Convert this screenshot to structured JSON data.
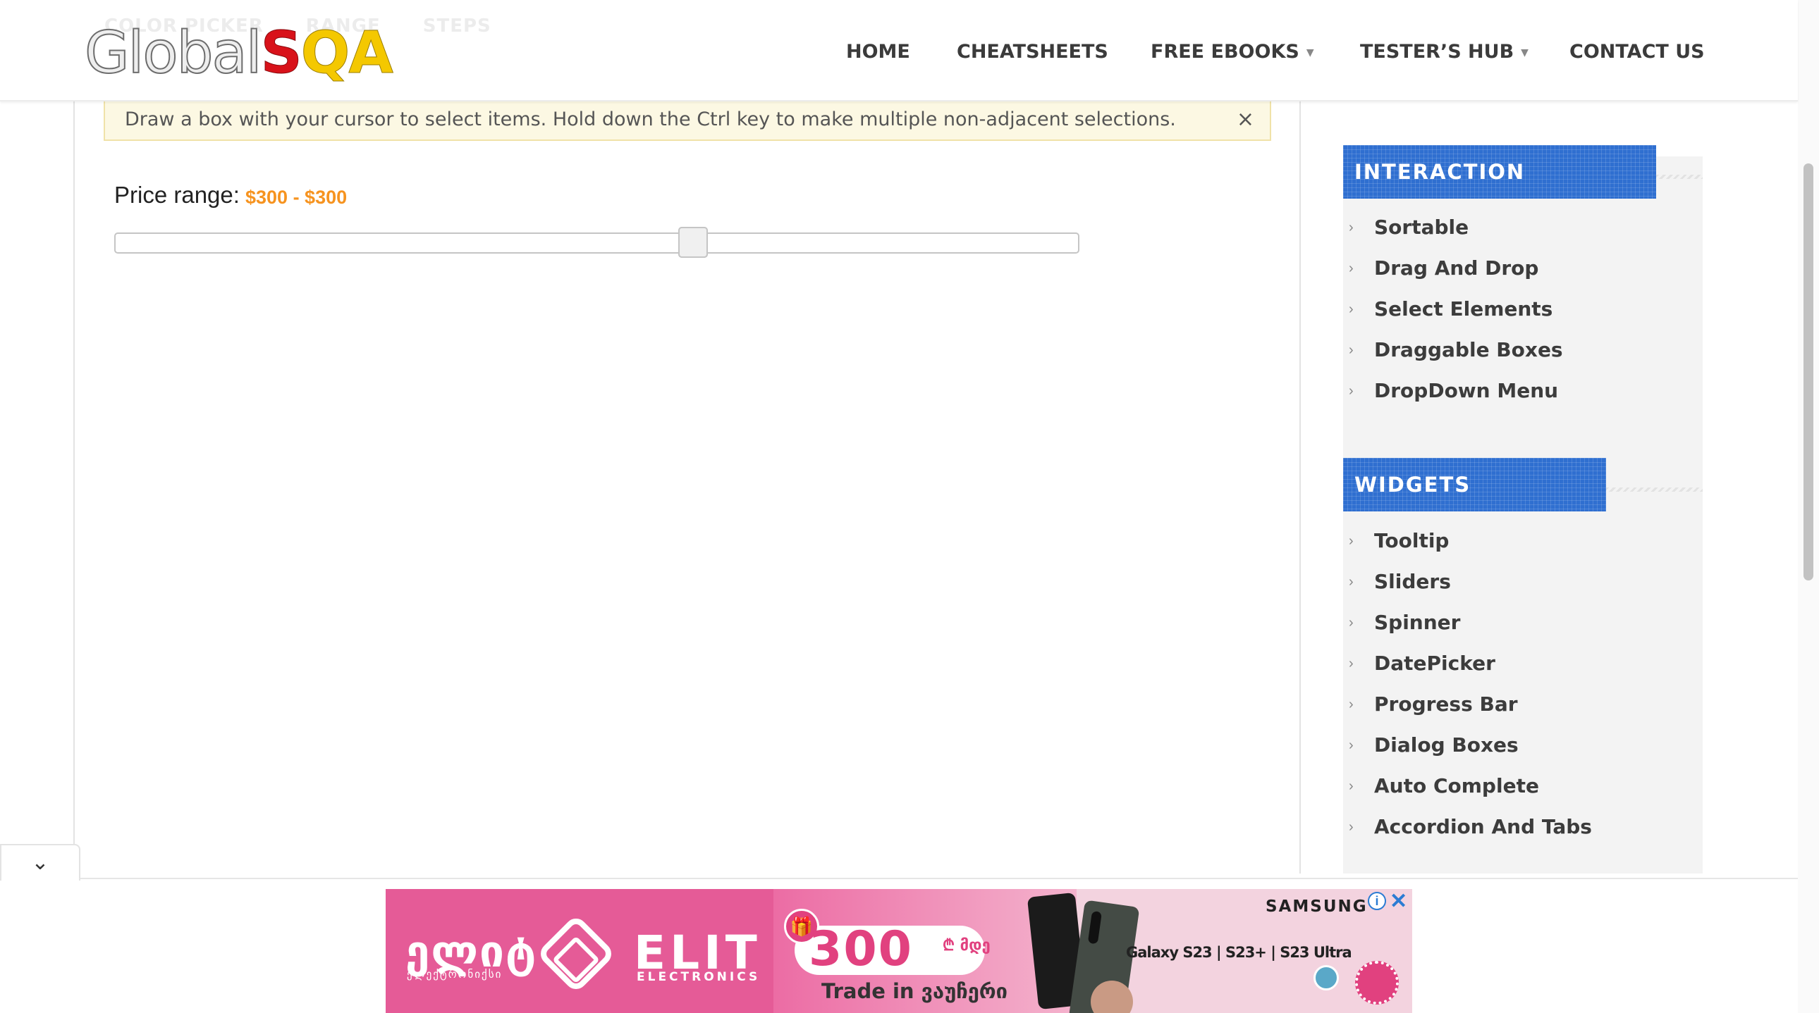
{
  "header": {
    "ghost_tabs": [
      "COLOR PICKER",
      "RANGE",
      "STEPS"
    ],
    "logo": {
      "part1": "Global",
      "part2": "S",
      "part3": "QA"
    },
    "nav": [
      {
        "label": "HOME",
        "has_dropdown": false
      },
      {
        "label": "CHEATSHEETS",
        "has_dropdown": false
      },
      {
        "label": "FREE EBOOKS",
        "has_dropdown": true
      },
      {
        "label": "TESTER’S HUB",
        "has_dropdown": true
      },
      {
        "label": "CONTACT US",
        "has_dropdown": false
      }
    ]
  },
  "main": {
    "notice_text": "Draw a box with your cursor to select items. Hold down the Ctrl key to make multiple non-adjacent selections.",
    "notice_close": "×",
    "price_label": "Price range:",
    "price_value": "$300 - $300",
    "slider": {
      "min_value_fraction": 0.6,
      "max_value_fraction": 0.6
    }
  },
  "sidebar": {
    "interaction_title": "INTERACTION",
    "interaction_items": [
      "Sortable",
      "Drag And Drop",
      "Select Elements",
      "Draggable Boxes",
      "DropDown Menu"
    ],
    "widgets_title": "WIDGETS",
    "widgets_items": [
      "Tooltip",
      "Sliders",
      "Spinner",
      "DatePicker",
      "Progress Bar",
      "Dialog Boxes",
      "Auto Complete",
      "Accordion And Tabs"
    ]
  },
  "collapse_icon": "⌄",
  "ad": {
    "brand_geo": "ელიტ",
    "brand_geo_sub": "ელექტრონიქსი",
    "brand": "ELIT",
    "brand_sub": "ELECTRONICS",
    "amount": "300",
    "amount_unit": "₾ მდე",
    "trade_in": "Trade in ვაუჩერი",
    "models": "Galaxy S23 | S23+ | S23 Ultra",
    "samsung": "SAMSUNG",
    "info": "i",
    "close": "✕",
    "accent_color": "#e55b97"
  },
  "colors": {
    "widget_title_bg": "#2f6fd0",
    "price_value": "#f6931f",
    "notice_bg": "#fcf8e3"
  }
}
